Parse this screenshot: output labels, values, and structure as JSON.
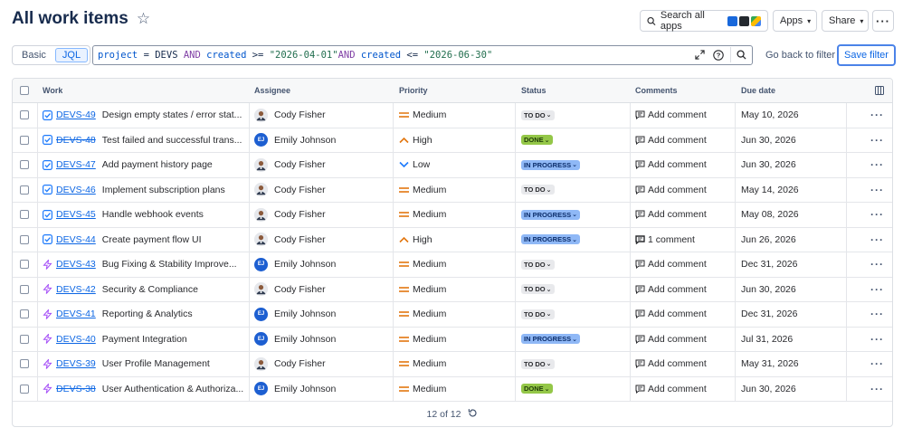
{
  "header": {
    "title": "All work items",
    "search_label": "Search all apps",
    "apps_label": "Apps",
    "share_label": "Share"
  },
  "query": {
    "modes": [
      "Basic",
      "JQL"
    ],
    "active_mode": "JQL",
    "jql_tokens": {
      "t1": "project",
      "t2": " = ",
      "t3": "DEVS",
      "t4": " AND ",
      "t5": "created",
      "t6": " >= ",
      "t7": "\"2026-04-01\"",
      "t8": "AND",
      "t9": " created",
      "t10": " <= ",
      "t11": "\"2026-06-30\""
    },
    "go_back_label": "Go back to filter",
    "save_label": "Save filter"
  },
  "table": {
    "columns": {
      "work": "Work",
      "assignee": "Assignee",
      "priority": "Priority",
      "status": "Status",
      "comments": "Comments",
      "due": "Due date"
    },
    "rows": [
      {
        "type": "task",
        "key": "DEVS-49",
        "done": false,
        "summary": "Design empty states / error stat...",
        "assignee": "Cody Fisher",
        "av": "photo",
        "priority": "Medium",
        "status": "TO DO",
        "comment": "Add comment",
        "due": "May 10, 2026"
      },
      {
        "type": "task",
        "key": "DEVS-48",
        "done": true,
        "summary": "Test failed and successful trans...",
        "assignee": "Emily Johnson",
        "av": "EJ",
        "priority": "High",
        "status": "DONE",
        "comment": "Add comment",
        "due": "Jun 30, 2026"
      },
      {
        "type": "task",
        "key": "DEVS-47",
        "done": false,
        "summary": "Add payment history page",
        "assignee": "Cody Fisher",
        "av": "photo",
        "priority": "Low",
        "status": "IN PROGRESS",
        "comment": "Add comment",
        "due": "Jun 30, 2026"
      },
      {
        "type": "task",
        "key": "DEVS-46",
        "done": false,
        "summary": "Implement subscription plans",
        "assignee": "Cody Fisher",
        "av": "photo",
        "priority": "Medium",
        "status": "TO DO",
        "comment": "Add comment",
        "due": "May 14, 2026"
      },
      {
        "type": "task",
        "key": "DEVS-45",
        "done": false,
        "summary": "Handle webhook events",
        "assignee": "Cody Fisher",
        "av": "photo",
        "priority": "Medium",
        "status": "IN PROGRESS",
        "comment": "Add comment",
        "due": "May 08, 2026"
      },
      {
        "type": "task",
        "key": "DEVS-44",
        "done": false,
        "summary": "Create payment flow UI",
        "assignee": "Cody Fisher",
        "av": "photo",
        "priority": "High",
        "status": "IN PROGRESS",
        "comment": "1 comment",
        "due": "Jun 26, 2026"
      },
      {
        "type": "epic",
        "key": "DEVS-43",
        "done": false,
        "summary": "Bug Fixing & Stability Improve...",
        "assignee": "Emily Johnson",
        "av": "EJ",
        "priority": "Medium",
        "status": "TO DO",
        "comment": "Add comment",
        "due": "Dec 31, 2026"
      },
      {
        "type": "epic",
        "key": "DEVS-42",
        "done": false,
        "summary": "Security & Compliance",
        "assignee": "Cody Fisher",
        "av": "photo",
        "priority": "Medium",
        "status": "TO DO",
        "comment": "Add comment",
        "due": "Jun 30, 2026"
      },
      {
        "type": "epic",
        "key": "DEVS-41",
        "done": false,
        "summary": "Reporting & Analytics",
        "assignee": "Emily Johnson",
        "av": "EJ",
        "priority": "Medium",
        "status": "TO DO",
        "comment": "Add comment",
        "due": "Dec 31, 2026"
      },
      {
        "type": "epic",
        "key": "DEVS-40",
        "done": false,
        "summary": "Payment Integration",
        "assignee": "Emily Johnson",
        "av": "EJ",
        "priority": "Medium",
        "status": "IN PROGRESS",
        "comment": "Add comment",
        "due": "Jul 31, 2026"
      },
      {
        "type": "epic",
        "key": "DEVS-39",
        "done": false,
        "summary": "User Profile Management",
        "assignee": "Cody Fisher",
        "av": "photo",
        "priority": "Medium",
        "status": "TO DO",
        "comment": "Add comment",
        "due": "May 31, 2026"
      },
      {
        "type": "epic",
        "key": "DEVS-38",
        "done": true,
        "summary": "User Authentication & Authoriza...",
        "assignee": "Emily Johnson",
        "av": "EJ",
        "priority": "Medium",
        "status": "DONE",
        "comment": "Add comment",
        "due": "Jun 30, 2026"
      }
    ],
    "pagination": "12 of 12"
  },
  "colors": {
    "accent": "#0c66e4",
    "task_icon": "#1d7afc",
    "epic_icon": "#a54ff7",
    "priority_medium": "#e2760f",
    "priority_high": "#e2760f",
    "priority_low": "#1d7afc"
  }
}
